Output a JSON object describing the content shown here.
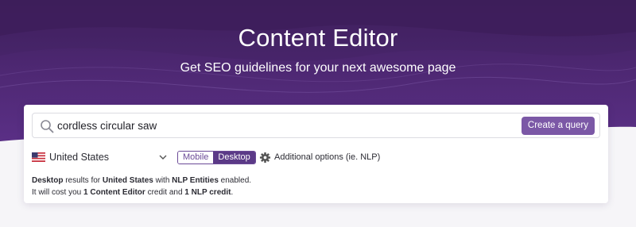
{
  "header": {
    "title": "Content Editor",
    "subtitle": "Get SEO guidelines for your next awesome page"
  },
  "search": {
    "value": "cordless circular saw",
    "button_label": "Create a query"
  },
  "options": {
    "country": "United States",
    "device_options": [
      "Mobile",
      "Desktop"
    ],
    "selected_device": "Desktop",
    "additional_label": "Additional options (ie. NLP)"
  },
  "info": {
    "line1": {
      "device": "Desktop",
      "t1": " results for ",
      "country": "United States",
      "t2": " with ",
      "entities": "NLP Entities",
      "t3": " enabled."
    },
    "line2": {
      "t1": "It will cost you ",
      "ce_credit": "1 Content Editor",
      "t2": " credit and ",
      "nlp_credit": "1 NLP credit",
      "t3": "."
    }
  },
  "colors": {
    "hero_bg": "#4e2873",
    "accent": "#7b58a6",
    "toggle_active": "#5b3a87"
  },
  "icons": [
    "search-icon",
    "us-flag-icon",
    "chevron-down-icon",
    "gear-icon"
  ]
}
